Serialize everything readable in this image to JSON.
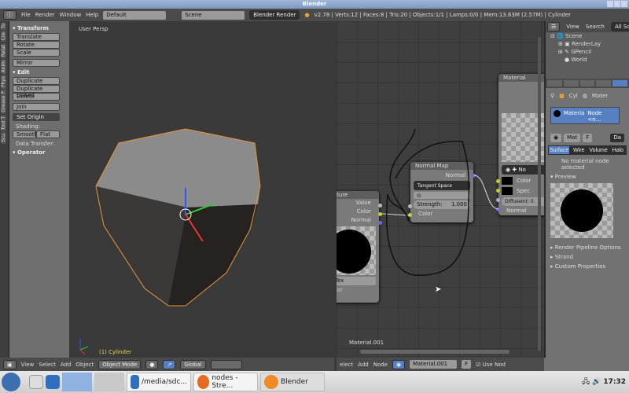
{
  "window": {
    "title": "Blender"
  },
  "topbar": {
    "menus": [
      "File",
      "Render",
      "Window",
      "Help"
    ],
    "layout": "Default",
    "scene": "Scene",
    "engine": "Blender Render",
    "stats": "v2.78 | Verts:12 | Faces:8 | Tris:20 | Objects:1/1 | Lamps:0/0 | Mem:13.63M (2.57M) | Cylinder"
  },
  "tool_tabs": [
    "To",
    "Cre",
    "Relat",
    "Anim",
    "Phys",
    "Grease P",
    "Tool T",
    "Scu"
  ],
  "tools": {
    "transform_header": "Transform",
    "transform": [
      "Translate",
      "Rotate",
      "Scale"
    ],
    "mirror": "Mirror",
    "edit_header": "Edit",
    "edit": [
      "Duplicate",
      "Duplicate Linked",
      "Delete"
    ],
    "join": "Join",
    "set_origin": "Set Origin",
    "shading_label": "Shading:",
    "smooth": "Smooth",
    "flat": "Flat",
    "data_transfer": "Data Transfer:",
    "operator_header": "Operator"
  },
  "viewport": {
    "view_label": "User Persp",
    "object_label": "(1) Cylinder"
  },
  "viewport_header": {
    "menus": [
      "View",
      "Select",
      "Add",
      "Object"
    ],
    "mode": "Object Mode",
    "orientation": "Global"
  },
  "nodes": {
    "texture": {
      "title": "xture",
      "outputs": [
        "Value",
        "Color",
        "Normal"
      ],
      "tex_field": "Tex",
      "footer": "ctor"
    },
    "normal_map": {
      "title": "Normal Map",
      "output": "Normal",
      "space": "Tangent Space",
      "strength_label": "Strength:",
      "strength_value": "1.000",
      "input": "Color"
    },
    "material": {
      "title": "Material",
      "selector": "No",
      "inputs": [
        "Color",
        "Spec"
      ],
      "diffuse": "DiffuseInt: 0.",
      "normal": "Normal"
    },
    "tree_name": "Material.001"
  },
  "node_header": {
    "menus": [
      "elect",
      "Add",
      "Node"
    ],
    "material": "Material.001",
    "fake": "F",
    "use_nodes": "Use Nod"
  },
  "outliner": {
    "menus": [
      "View",
      "Search"
    ],
    "filter": "All Sce",
    "items": [
      "Scene",
      "RenderLay",
      "GPencil",
      "World"
    ]
  },
  "properties": {
    "breadcrumb": [
      "Cyl",
      "Mater"
    ],
    "slot": {
      "name": "Materia",
      "node": "Node <n..."
    },
    "mat_name": "Mat",
    "fake": "F",
    "data": "Da",
    "tabs": [
      "Surface",
      "Wire",
      "Volume",
      "Halo"
    ],
    "active_tab": "Surface",
    "message": "No material node selected",
    "preview": "Preview",
    "panels": [
      "Render Pipeline Options",
      "Strand",
      "Custom Properties"
    ]
  },
  "taskbar": {
    "tasks": [
      "/media/sdc...",
      "nodes - Stre...",
      "Blender"
    ],
    "clock": "17:32"
  }
}
